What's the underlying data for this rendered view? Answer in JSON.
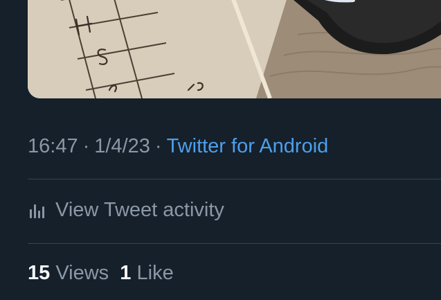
{
  "tweet": {
    "time": "16:47",
    "separator": "·",
    "date": "1/4/23",
    "source": "Twitter for Android"
  },
  "activity": {
    "icon": "analytics-bar-chart-icon",
    "label": "View Tweet activity"
  },
  "stats": {
    "views_count": "15",
    "views_label": "Views",
    "likes_count": "1",
    "likes_label": "Like"
  },
  "colors": {
    "background": "#15202b",
    "secondary_text": "#8b98a5",
    "link": "#4d9fec",
    "primary_text": "#f7f9f9",
    "divider": "#38444d"
  }
}
